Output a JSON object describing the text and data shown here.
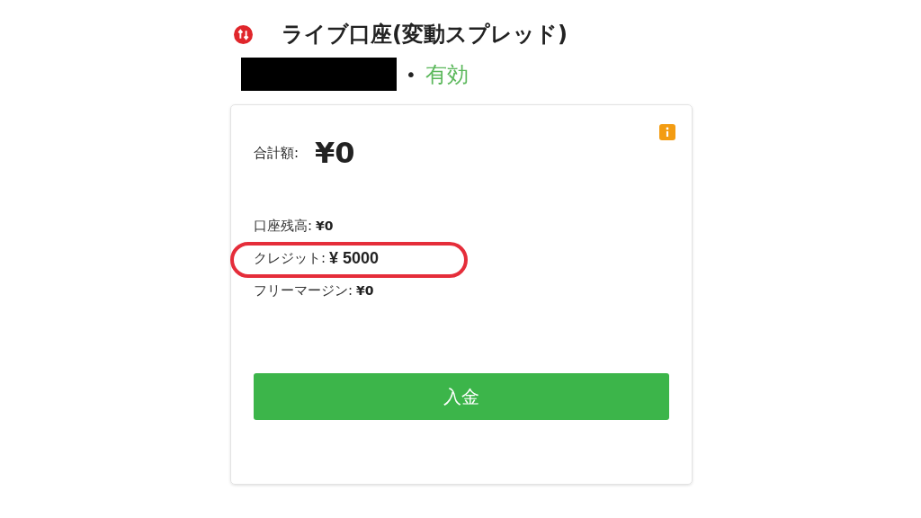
{
  "account": {
    "title": "ライブ口座(変動スプレッド)",
    "separator": "•",
    "status": "有効",
    "active": true
  },
  "card": {
    "total_label": "合計額:",
    "total_value": "¥0",
    "rows": [
      {
        "label": "口座残高:",
        "value": "¥0",
        "highlighted": false
      },
      {
        "label": "クレジット:",
        "value": "¥ 5000",
        "highlighted": true
      },
      {
        "label": "フリーマージン:",
        "value": "¥0",
        "highlighted": false
      }
    ],
    "button": "入金"
  }
}
